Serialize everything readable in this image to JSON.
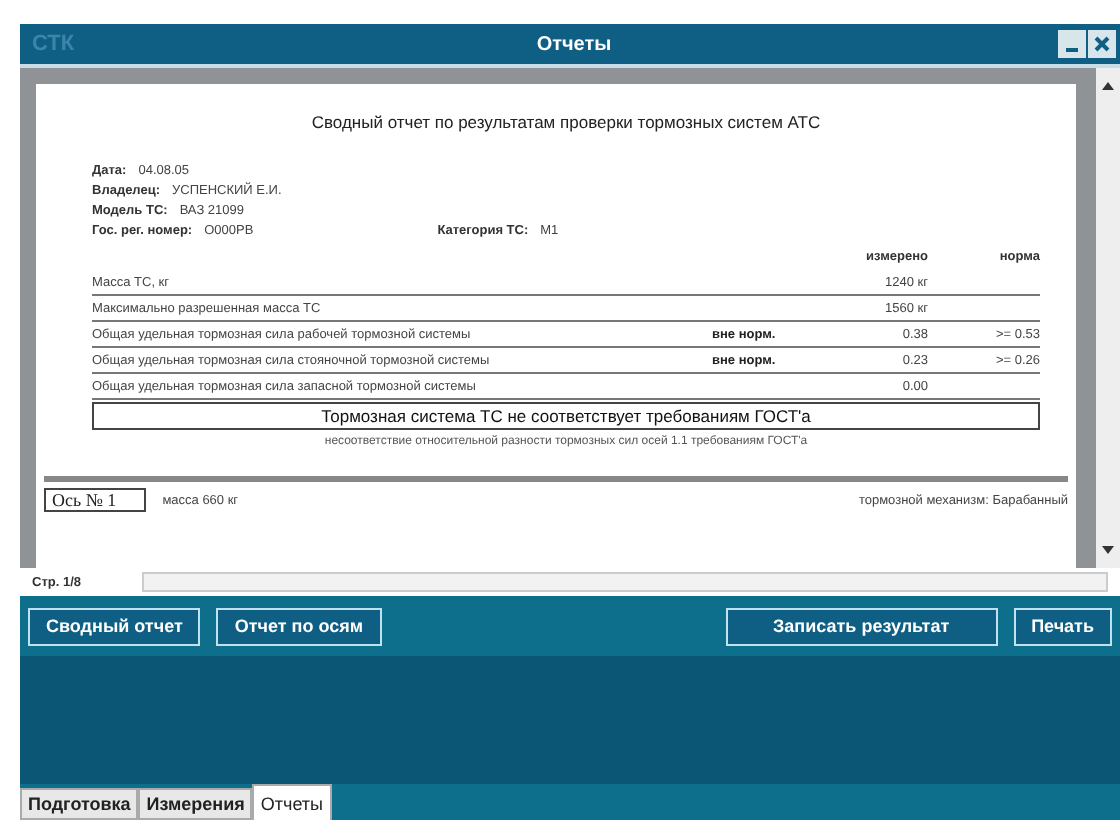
{
  "window": {
    "logo": "СТК",
    "title": "Отчеты"
  },
  "report": {
    "title": "Сводный отчет по результатам проверки тормозных систем АТС",
    "fields": [
      {
        "label": "Дата:",
        "value": "04.08.05"
      },
      {
        "label": "Владелец:",
        "value": "УСПЕНСКИЙ Е.И."
      },
      {
        "label": "Модель ТС:",
        "value": "ВАЗ 21099"
      },
      {
        "label": "Гос. рег. номер:",
        "value": "О000РВ",
        "extra_label": "Категория ТС:",
        "extra_value": "М1"
      }
    ],
    "columns": [
      "измерено",
      "норма"
    ],
    "rows": [
      {
        "name": "Масса ТС, кг",
        "status": "",
        "measured": "1240 кг",
        "norm": ""
      },
      {
        "name": "Максимально разрешенная масса ТС",
        "status": "",
        "measured": "1560 кг",
        "norm": ""
      },
      {
        "name": "Общая удельная тормозная сила рабочей тормозной системы",
        "status": "вне норм.",
        "measured": "0.38",
        "norm": ">= 0.53"
      },
      {
        "name": "Общая удельная тормозная сила стояночной тормозной системы",
        "status": "вне норм.",
        "measured": "0.23",
        "norm": ">= 0.26"
      },
      {
        "name": "Общая удельная тормозная сила запасной тормозной системы",
        "status": "",
        "measured": "0.00",
        "norm": ""
      }
    ],
    "verdict": "Тормозная система ТС не соответствует требованиям ГОСТ'а",
    "note": "несоответствие относительной разности тормозных сил осей 1.1 требованиям ГОСТ'а",
    "axle": {
      "label": "Ось № 1",
      "mass": "масса 660 кг",
      "mechanism": "тормозной механизм: Барабанный"
    }
  },
  "page_indicator": "Стр. 1/8",
  "buttons": [
    "Сводный отчет",
    "Отчет по осям",
    "Записать результат",
    "Печать"
  ],
  "tabs": [
    {
      "label": "Подготовка",
      "selected": false
    },
    {
      "label": "Измерения",
      "selected": false
    },
    {
      "label": "Отчеты",
      "selected": true
    }
  ]
}
